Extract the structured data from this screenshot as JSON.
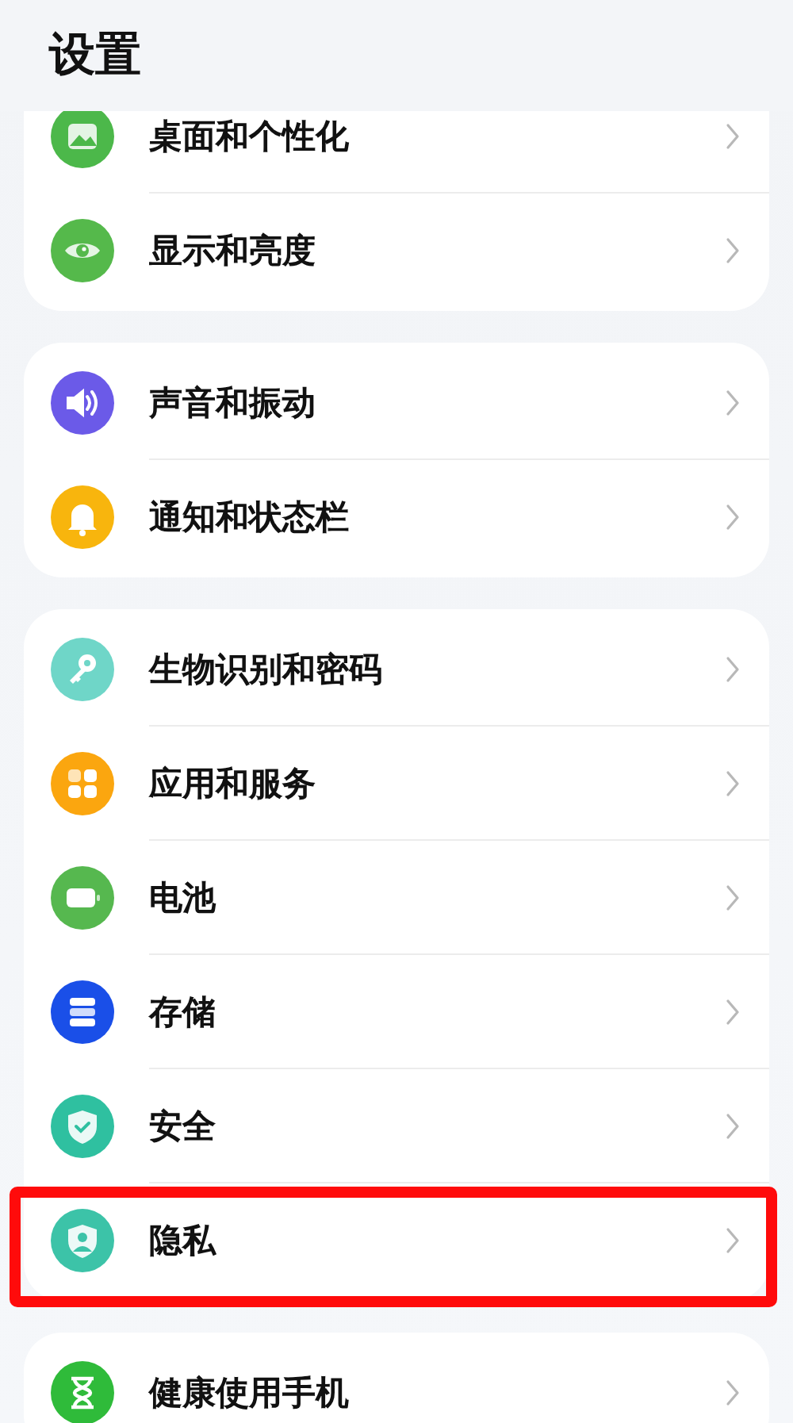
{
  "title": "设置",
  "groups": [
    {
      "items": [
        {
          "label": "桌面和个性化",
          "color": "#4cb84a",
          "highlighted": false
        },
        {
          "label": "显示和亮度",
          "color": "#55b94b",
          "highlighted": false
        }
      ]
    },
    {
      "items": [
        {
          "label": "声音和振动",
          "color": "#6b5ae8",
          "highlighted": false
        },
        {
          "label": "通知和状态栏",
          "color": "#f8b50d",
          "highlighted": false
        }
      ]
    },
    {
      "items": [
        {
          "label": "生物识别和密码",
          "color": "#6fd6c8",
          "highlighted": false
        },
        {
          "label": "应用和服务",
          "color": "#fba60f",
          "highlighted": false
        },
        {
          "label": "电池",
          "color": "#56b84f",
          "highlighted": false
        },
        {
          "label": "存储",
          "color": "#1a4fe8",
          "highlighted": false
        },
        {
          "label": "安全",
          "color": "#2fc0a0",
          "highlighted": false
        },
        {
          "label": "隐私",
          "color": "#3cc3a8",
          "highlighted": true
        }
      ]
    },
    {
      "items": [
        {
          "label": "健康使用手机",
          "color": "#2fbb3a",
          "highlighted": false
        }
      ]
    }
  ]
}
